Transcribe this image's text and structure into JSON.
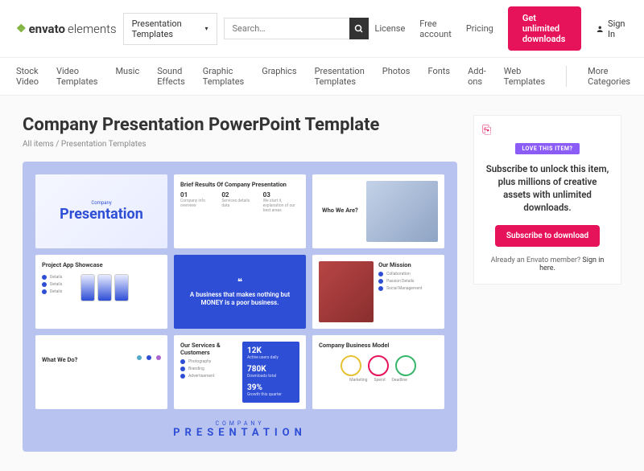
{
  "header": {
    "logo_brand": "envato",
    "logo_suffix": "elements",
    "category_selector": "Presentation Templates",
    "search_placeholder": "Search…",
    "links": {
      "license": "License",
      "free": "Free account",
      "pricing": "Pricing"
    },
    "cta": "Get unlimited downloads",
    "signin": "Sign In"
  },
  "nav": [
    "Stock Video",
    "Video Templates",
    "Music",
    "Sound Effects",
    "Graphic Templates",
    "Graphics",
    "Presentation Templates",
    "Photos",
    "Fonts",
    "Add-ons",
    "Web Templates"
  ],
  "nav_more": "More Categories",
  "title": "Company Presentation PowerPoint Template",
  "breadcrumb": {
    "root": "All items",
    "sep": " / ",
    "leaf": "Presentation Templates"
  },
  "slides": {
    "hero": {
      "sub": "Company",
      "title": "Presentation"
    },
    "brief": {
      "heading": "Brief Results Of Company Presentation",
      "cols": [
        {
          "n": "01",
          "t": "Company info overview"
        },
        {
          "n": "02",
          "t": "Services details data"
        },
        {
          "n": "03",
          "t": "We start it, explanation of our best areas"
        }
      ]
    },
    "who": {
      "heading": "Who We Are?"
    },
    "project": {
      "heading": "Project App Showcase"
    },
    "quote": "A business that makes nothing but MONEY is a poor business.",
    "mission": {
      "heading": "Our Mission",
      "items": [
        "Collaboration",
        "Passion Details",
        "Social Management"
      ]
    },
    "whatwedo": {
      "heading": "What We Do?"
    },
    "services": {
      "heading": "Our Services & Customers",
      "items": [
        "Photography",
        "Branding",
        "Advertisement"
      ]
    },
    "stats": [
      {
        "n": "12K",
        "l": "Active users daily"
      },
      {
        "n": "780K",
        "l": "Downloads total"
      },
      {
        "n": "39%",
        "l": "Growth this quarter"
      }
    ],
    "bizmodel": {
      "heading": "Company Business Model",
      "labels": [
        "Marketing",
        "Spend",
        "Deadline"
      ]
    },
    "brand": {
      "sub": "COMPANY",
      "main": "PRESENTATION"
    }
  },
  "sidebar": {
    "badge": "LOVE THIS ITEM?",
    "text": "Subscribe to unlock this item, plus millions of creative assets with unlimited downloads.",
    "button": "Subscribe to download",
    "note_pre": "Already an Envato member? ",
    "note_link": "Sign in here."
  }
}
